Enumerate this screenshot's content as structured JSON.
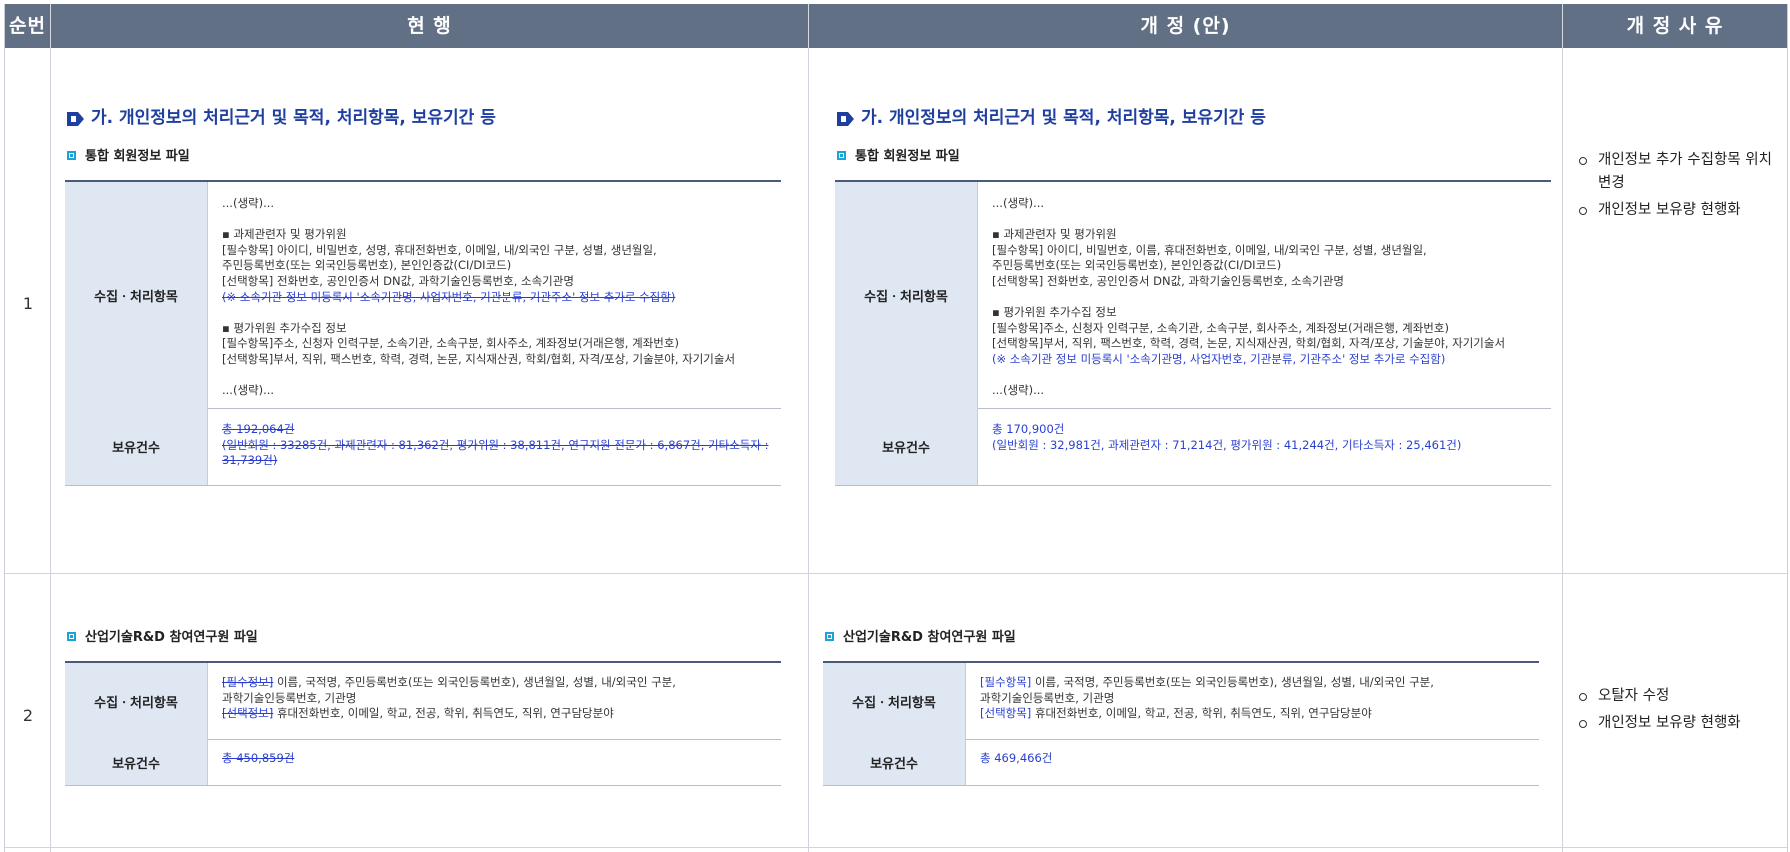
{
  "header": {
    "no": "순번",
    "current": "현 행",
    "revised": "개 정 (안)",
    "reason": "개 정 사 유"
  },
  "rows": [
    {
      "no": "1",
      "current": {
        "section_title": "가. 개인정보의 처리근거 및 목적, 처리항목, 보유기간 등",
        "sub_title": "통합 회원정보 파일",
        "collect_label": "수집ㆍ처리항목",
        "collect_lines": [
          "...(생략)...",
          "",
          "▪ 과제관련자 및 평가위원",
          " [필수항목] 아이디, 비밀번호, 성명, 휴대전화번호, 이메일, 내/외국인 구분, 성별, 생년월일,",
          " 주민등록번호(또는 외국인등록번호), 본인인증값(CI/DI코드)",
          " [선택항목] 전화번호, 공인인증서 DN값, 과학기술인등록번호, 소속기관명",
          " (※ 소속기관 정보 미등록시 '소속기관명, 사업자번호, 기관분류, 기관주소' 정보 추가로 수집함)",
          "",
          "▪ 평가위원 추가수집 정보",
          " [필수항목]주소, 신청자 인력구분, 소속기관, 소속구분, 회사주소, 계좌정보(거래은행, 계좌번호)",
          " [선택항목]부서, 직위, 팩스번호, 학력, 경력, 논문, 지식재산권, 학회/협회, 자격/포상, 기술분야, 자기기술서",
          "",
          "...(생략)..."
        ],
        "retention_label": "보유건수",
        "retention_lines": [
          "총 192,064건",
          "(일반회원 : 33285건, 과제관련자 : 81,362건, 평가위원 : 38,811건, 연구지원 전문가 : 6,867건, 기타소득자 :",
          "31,739건)"
        ]
      },
      "revised": {
        "section_title": "가. 개인정보의 처리근거 및 목적, 처리항목, 보유기간 등",
        "sub_title": "통합 회원정보 파일",
        "collect_label": "수집ㆍ처리항목",
        "collect_lines": [
          "...(생략)...",
          "",
          "▪ 과제관련자 및 평가위원",
          " [필수항목] 아이디, 비밀번호, 이름, 휴대전화번호, 이메일, 내/외국인 구분, 성별, 생년월일,",
          " 주민등록번호(또는 외국인등록번호), 본인인증값(CI/DI코드)",
          " [선택항목] 전화번호, 공인인증서 DN값, 과학기술인등록번호, 소속기관명",
          "",
          "▪ 평가위원 추가수집 정보",
          " [필수항목]주소, 신청자 인력구분, 소속기관, 소속구분, 회사주소, 계좌정보(거래은행, 계좌번호)",
          " [선택항목]부서, 직위, 팩스번호, 학력, 경력, 논문, 지식재산권, 학회/협회, 자격/포상, 기술분야, 자기기술서",
          "(※ 소속기관 정보 미등록시 '소속기관명, 사업자번호, 기관분류, 기관주소' 정보 추가로 수집함)",
          "",
          "...(생략)..."
        ],
        "retention_label": "보유건수",
        "retention_lines": [
          "총 170,900건",
          "(일반회원 : 32,981건, 과제관련자 : 71,214건, 평가위원 : 41,244건, 기타소득자 : 25,461건)"
        ]
      },
      "reasons": [
        "개인정보 추가 수집항목 위치변경",
        "개인정보 보유량 현행화"
      ]
    },
    {
      "no": "2",
      "current": {
        "sub_title": "산업기술R&D 참여연구원 파일",
        "collect_label": "수집ㆍ처리항목",
        "collect_lines": [
          [
            "[필수정보]",
            " 이름, 국적명, 주민등록번호(또는 외국인등록번호), 생년월일, 성별, 내/외국인 구분,"
          ],
          [
            "",
            " 과학기술인등록번호, 기관명"
          ],
          [
            "[선택정보]",
            " 휴대전화번호, 이메일, 학교, 전공, 학위, 취득연도, 직위, 연구담당분야"
          ]
        ],
        "retention_label": "보유건수",
        "retention": "총 450,859건"
      },
      "revised": {
        "sub_title": "산업기술R&D 참여연구원 파일",
        "collect_label": "수집ㆍ처리항목",
        "collect_lines": [
          [
            "[필수항목]",
            " 이름, 국적명, 주민등록번호(또는 외국인등록번호), 생년월일, 성별, 내/외국인 구분,"
          ],
          [
            "",
            " 과학기술인등록번호, 기관명"
          ],
          [
            "[선택항목]",
            " 휴대전화번호, 이메일, 학교, 전공, 학위, 취득연도, 직위, 연구담당분야"
          ]
        ],
        "retention_label": "보유건수",
        "retention": "총 469,466건"
      },
      "reasons": [
        "오탈자 수정",
        "개인정보 보유량 현행화"
      ]
    }
  ]
}
